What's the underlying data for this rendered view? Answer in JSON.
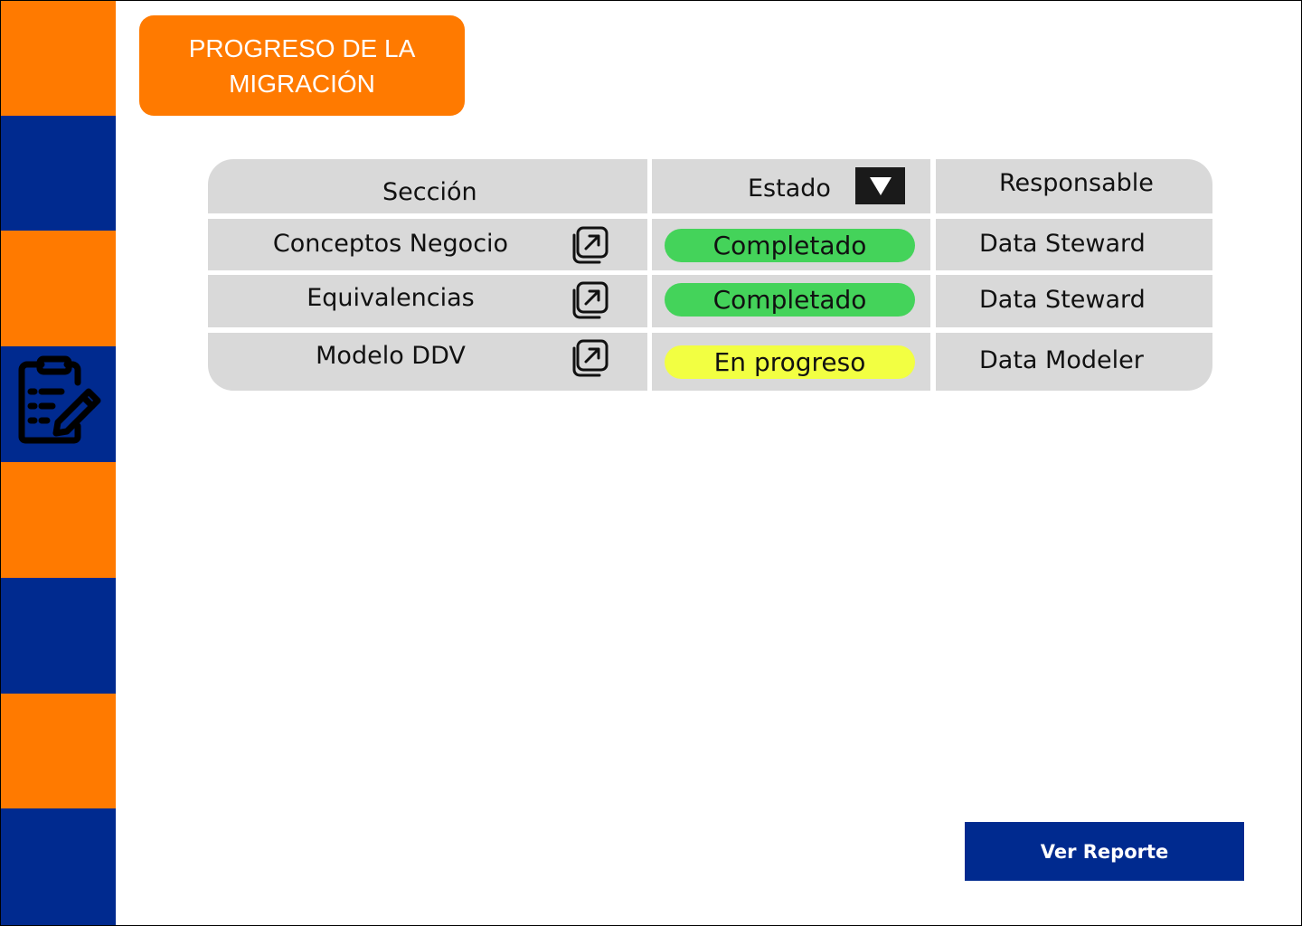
{
  "header": {
    "title": "PROGRESO DE LA MIGRACIÓN"
  },
  "sidebar": {
    "icon": "clipboard-edit-icon",
    "colors": {
      "orange": "#FF7A00",
      "blue": "#002A8F"
    }
  },
  "table": {
    "columns": {
      "section": "Sección",
      "status": "Estado",
      "owner": "Responsable"
    },
    "status_filter_icon": "triangle-down-icon",
    "rows": [
      {
        "section": "Conceptos Negocio",
        "status": "Completado",
        "status_color": "#44D35A",
        "owner": "Data Steward",
        "link_icon": "open-external-icon"
      },
      {
        "section": "Equivalencias",
        "status": "Completado",
        "status_color": "#44D35A",
        "owner": "Data Steward",
        "link_icon": "open-external-icon"
      },
      {
        "section": "Modelo DDV",
        "status": "En progreso",
        "status_color": "#F2FF42",
        "owner": "Data Modeler",
        "link_icon": "open-external-icon"
      }
    ]
  },
  "footer": {
    "report_button": "Ver Reporte"
  }
}
